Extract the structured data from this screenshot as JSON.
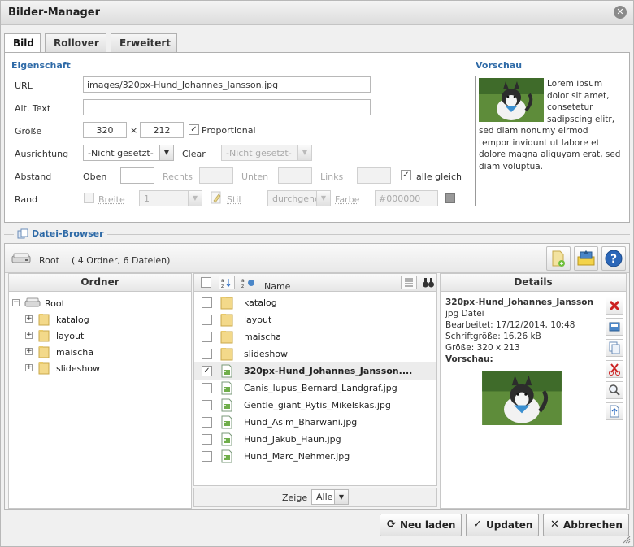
{
  "window": {
    "title": "Bilder-Manager"
  },
  "tabs": [
    {
      "label": "Bild",
      "active": true
    },
    {
      "label": "Rollover",
      "active": false
    },
    {
      "label": "Erweitert",
      "active": false
    }
  ],
  "properties": {
    "heading": "Eigenschaft",
    "url_label": "URL",
    "url_value": "images/320px-Hund_Johannes_Jansson.jpg",
    "alt_label": "Alt. Text",
    "alt_value": "",
    "size_label": "Größe",
    "width_value": "320",
    "times": "×",
    "height_value": "212",
    "proportional_label": "Proportional",
    "proportional_checked": true,
    "align_label": "Ausrichtung",
    "align_value": "-Nicht gesetzt-",
    "clear_label": "Clear",
    "clear_value": "-Nicht gesetzt-",
    "spacing_label": "Abstand",
    "top_label": "Oben",
    "right_label": "Rechts",
    "bottom_label": "Unten",
    "left_label": "Links",
    "all_equal_label": "alle gleich",
    "all_equal_checked": true,
    "border_label": "Rand",
    "border_width_label": "Breite",
    "border_width_value": "1",
    "border_style_label": "Stil",
    "border_style_value": "durchgehend",
    "border_color_label": "Farbe",
    "border_color_value": "#000000"
  },
  "preview": {
    "heading": "Vorschau",
    "text": "Lorem ipsum dolor sit amet, consetetur sadipscing elitr, sed diam nonumy eirmod tempor invidunt ut labore et dolore magna aliquyam erat, sed diam voluptua."
  },
  "browser": {
    "legend": "Datei-Browser",
    "root_label": "Root",
    "root_summary": "( 4 Ordner, 6 Dateien)",
    "folders_header": "Ordner",
    "tree": [
      {
        "label": "Root",
        "root": true
      },
      {
        "label": "katalog"
      },
      {
        "label": "layout"
      },
      {
        "label": "maischa"
      },
      {
        "label": "slideshow"
      }
    ],
    "name_header": "Name",
    "files": [
      {
        "name": "katalog",
        "type": "folder",
        "checked": false,
        "selected": false
      },
      {
        "name": "layout",
        "type": "folder",
        "checked": false,
        "selected": false
      },
      {
        "name": "maischa",
        "type": "folder",
        "checked": false,
        "selected": false
      },
      {
        "name": "slideshow",
        "type": "folder",
        "checked": false,
        "selected": false
      },
      {
        "name": "320px-Hund_Johannes_Jansson....",
        "type": "image",
        "checked": true,
        "selected": true
      },
      {
        "name": "Canis_lupus_Bernard_Landgraf.jpg",
        "type": "image",
        "checked": false,
        "selected": false
      },
      {
        "name": "Gentle_giant_Rytis_Mikelskas.jpg",
        "type": "image",
        "checked": false,
        "selected": false
      },
      {
        "name": "Hund_Asim_Bharwani.jpg",
        "type": "image",
        "checked": false,
        "selected": false
      },
      {
        "name": "Hund_Jakub_Haun.jpg",
        "type": "image",
        "checked": false,
        "selected": false
      },
      {
        "name": "Hund_Marc_Nehmer.jpg",
        "type": "image",
        "checked": false,
        "selected": false
      }
    ],
    "show_label": "Zeige",
    "show_value": "Alle",
    "details_header": "Details",
    "details": {
      "filename": "320px-Hund_Johannes_Jansson",
      "filetype": "jpg Datei",
      "modified": "Bearbeitet: 17/12/2014, 10:48",
      "filesize": "Schriftgröße: 16.26 kB",
      "dimensions": "Größe: 320 x 213",
      "preview_label": "Vorschau:"
    }
  },
  "actions": {
    "reload": "Neu laden",
    "update": "Updaten",
    "cancel": "Abbrechen"
  },
  "colors": {
    "heading_blue": "#2e6aa7",
    "delete_red": "#cc2222"
  }
}
